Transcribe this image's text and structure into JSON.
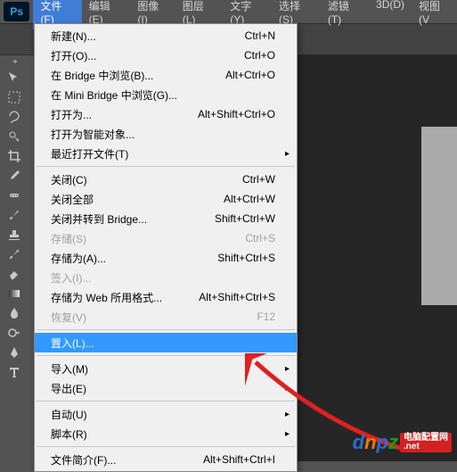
{
  "app": {
    "logo_text": "Ps"
  },
  "menubar": {
    "items": [
      {
        "label": "文件(F)"
      },
      {
        "label": "编辑(E)"
      },
      {
        "label": "图像(I)"
      },
      {
        "label": "图层(L)"
      },
      {
        "label": "文字(Y)"
      },
      {
        "label": "选择(S)"
      },
      {
        "label": "滤镜(T)"
      },
      {
        "label": "3D(D)"
      },
      {
        "label": "视图(V"
      }
    ],
    "open_index": 0
  },
  "dropdown": {
    "items": [
      {
        "label": "新建(N)...",
        "shortcut": "Ctrl+N",
        "type": "item"
      },
      {
        "label": "打开(O)...",
        "shortcut": "Ctrl+O",
        "type": "item"
      },
      {
        "label": "在 Bridge 中浏览(B)...",
        "shortcut": "Alt+Ctrl+O",
        "type": "item"
      },
      {
        "label": "在 Mini Bridge 中浏览(G)...",
        "shortcut": "",
        "type": "item"
      },
      {
        "label": "打开为...",
        "shortcut": "Alt+Shift+Ctrl+O",
        "type": "item"
      },
      {
        "label": "打开为智能对象...",
        "shortcut": "",
        "type": "item"
      },
      {
        "label": "最近打开文件(T)",
        "shortcut": "",
        "type": "submenu"
      },
      {
        "type": "separator"
      },
      {
        "label": "关闭(C)",
        "shortcut": "Ctrl+W",
        "type": "item"
      },
      {
        "label": "关闭全部",
        "shortcut": "Alt+Ctrl+W",
        "type": "item"
      },
      {
        "label": "关闭并转到 Bridge...",
        "shortcut": "Shift+Ctrl+W",
        "type": "item"
      },
      {
        "label": "存储(S)",
        "shortcut": "Ctrl+S",
        "type": "item",
        "disabled": true
      },
      {
        "label": "存储为(A)...",
        "shortcut": "Shift+Ctrl+S",
        "type": "item"
      },
      {
        "label": "签入(I)...",
        "shortcut": "",
        "type": "item",
        "disabled": true
      },
      {
        "label": "存储为 Web 所用格式...",
        "shortcut": "Alt+Shift+Ctrl+S",
        "type": "item"
      },
      {
        "label": "恢复(V)",
        "shortcut": "F12",
        "type": "item",
        "disabled": true
      },
      {
        "type": "separator"
      },
      {
        "label": "置入(L)...",
        "shortcut": "",
        "type": "item",
        "highlighted": true
      },
      {
        "type": "separator"
      },
      {
        "label": "导入(M)",
        "shortcut": "",
        "type": "submenu"
      },
      {
        "label": "导出(E)",
        "shortcut": "",
        "type": "submenu"
      },
      {
        "type": "separator"
      },
      {
        "label": "自动(U)",
        "shortcut": "",
        "type": "submenu"
      },
      {
        "label": "脚本(R)",
        "shortcut": "",
        "type": "submenu"
      },
      {
        "type": "separator"
      },
      {
        "label": "文件简介(F)...",
        "shortcut": "Alt+Shift+Ctrl+I",
        "type": "item"
      }
    ]
  },
  "tools": [
    "move-tool",
    "marquee-tool",
    "lasso-tool",
    "quick-select-tool",
    "crop-tool",
    "eyedropper-tool",
    "healing-tool",
    "brush-tool",
    "stamp-tool",
    "history-brush-tool",
    "eraser-tool",
    "gradient-tool",
    "blur-tool",
    "dodge-tool",
    "pen-tool",
    "type-tool"
  ],
  "watermark": {
    "url_text": "dnpz",
    "suffix_top": "电脑配置网",
    "suffix_bottom": ".net"
  }
}
